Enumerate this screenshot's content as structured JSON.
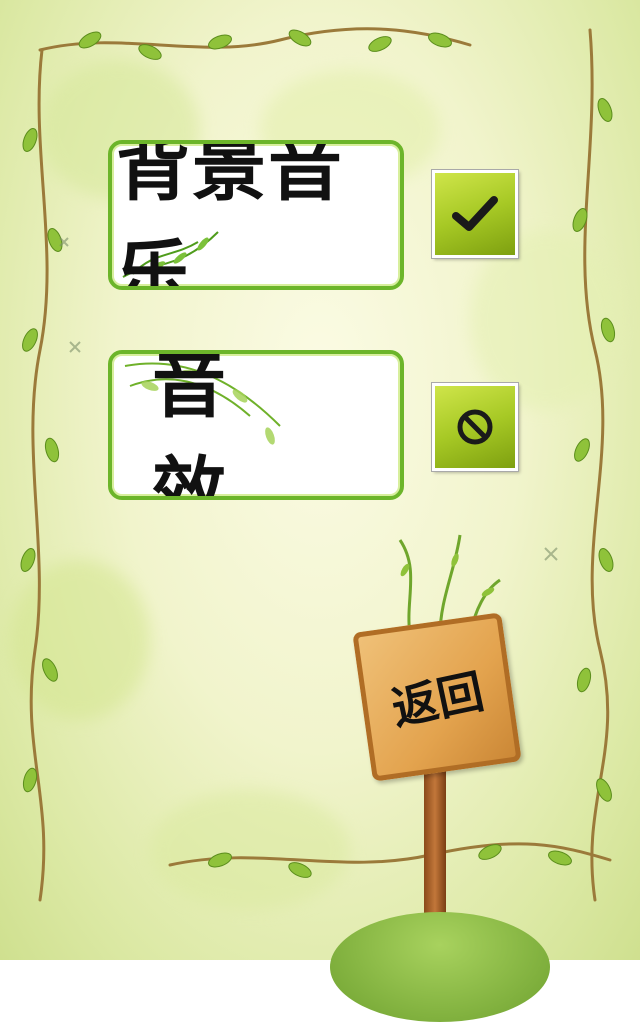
{
  "settings": {
    "music_label": "背景音乐",
    "sfx_label": "音效",
    "back_label": "返回"
  },
  "toggles": {
    "music_state": "on",
    "sfx_state": "off",
    "on_icon": "checkmark-icon",
    "off_icon": "prohibited-icon"
  },
  "colors": {
    "panel_border": "#6cb52a",
    "toggle_green": "#a7c925",
    "sign_wood": "#e3a34e",
    "background": "#f1f4cc"
  }
}
